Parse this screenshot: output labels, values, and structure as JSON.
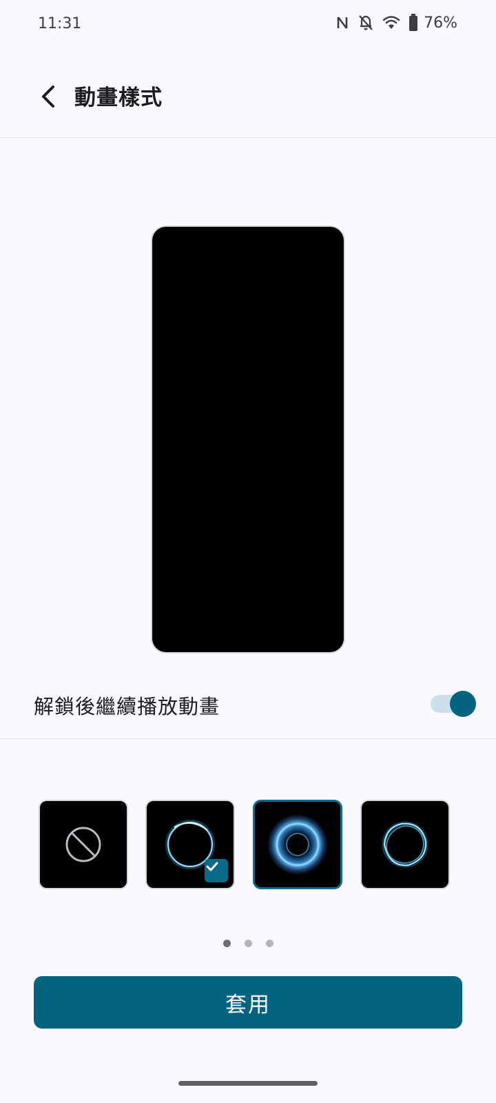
{
  "status_bar": {
    "time": "11:31",
    "battery": "76%",
    "icons": [
      "nfc-icon",
      "notifications-off-icon",
      "wifi-icon",
      "battery-icon"
    ]
  },
  "header": {
    "back_icon": "chevron-left-icon",
    "title": "動畫樣式"
  },
  "preview": {
    "icon": "phone-preview"
  },
  "settings": {
    "continue_after_unlock": {
      "label": "解鎖後繼續播放動畫",
      "enabled": true
    }
  },
  "styles": {
    "items": [
      {
        "icon": "none-icon",
        "selected": false,
        "focused": false
      },
      {
        "icon": "ring-thin-icon",
        "selected": true,
        "focused": false
      },
      {
        "icon": "ring-glow-icon",
        "selected": false,
        "focused": true
      },
      {
        "icon": "ring-wave-icon",
        "selected": false,
        "focused": false
      }
    ],
    "check_icon": "check-icon"
  },
  "pagination": {
    "pages": 3,
    "current": 1
  },
  "actions": {
    "apply_label": "套用"
  },
  "colors": {
    "accent": "#04637f",
    "background": "#f8fafd",
    "toggle_track": "#cbe0ea"
  }
}
